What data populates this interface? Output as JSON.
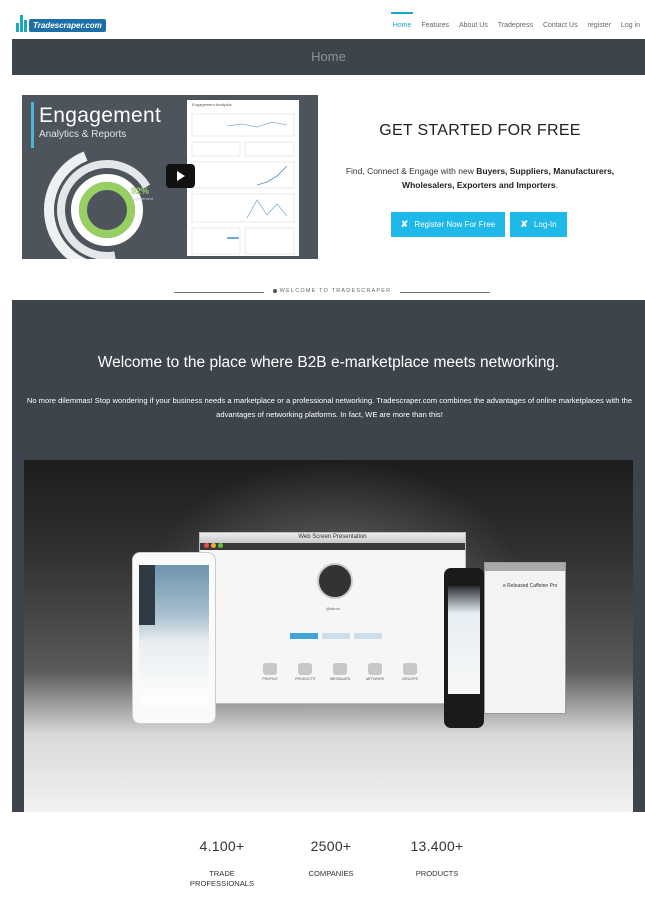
{
  "brand": {
    "logo_text": "Tradescraper.com",
    "accent": "#1eb9e8",
    "dark": "#3e444b"
  },
  "nav": {
    "items": [
      {
        "label": "Home",
        "active": true
      },
      {
        "label": "Features"
      },
      {
        "label": "About Us"
      },
      {
        "label": "Tradepress"
      },
      {
        "label": "Contact Us"
      },
      {
        "label": "register"
      },
      {
        "label": "Log in"
      }
    ]
  },
  "page_title": "Home",
  "video": {
    "title": "Engagement",
    "subtitle": "Analytics & Reports",
    "percent": "92%",
    "percent_caption": "engagement",
    "report_title": "Engagement Analytics"
  },
  "hero": {
    "title": "GET STARTED FOR FREE",
    "text_prefix": "Find, Connect & Engage with new ",
    "text_bold": "Buyers, Suppliers, Manufacturers, Wholesalers, Exporters and Importers",
    "text_suffix": ".",
    "register_label": "Register Now For Free",
    "login_label": "Log-In",
    "btn_icon": "✘"
  },
  "divider_label": "WELCOME TO TRADESCRAPER",
  "welcome": {
    "heading": "Welcome to the place where B2B e-marketplace meets networking.",
    "paragraph": "No more dilemmas! Stop wondering if your business needs a marketplace or a professional networking. Tradescraper.com combines the advantages of online marketplaces with the advantages of networking platforms. In fact, WE are more than this!"
  },
  "showcase": {
    "window_title": "Web Screen Presentation",
    "user_name": "@sbrnu",
    "icons": [
      "PROFILE",
      "PRODUCTS",
      "MESSAGES",
      "NETWORK",
      "GROUPS"
    ],
    "side_text": "e Released Caffeine Pro"
  },
  "stats": [
    {
      "number": "4.100+",
      "label": "TRADE PROFESSIONALS"
    },
    {
      "number": "2500+",
      "label": "COMPANIES"
    },
    {
      "number": "13.400+",
      "label": "PRODUCTS"
    }
  ]
}
